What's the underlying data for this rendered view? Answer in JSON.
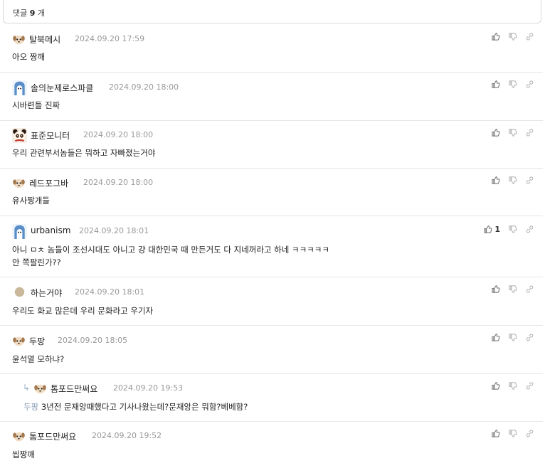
{
  "header": {
    "count_prefix": "댓글",
    "count": "9",
    "count_suffix": "개"
  },
  "comments": [
    {
      "author": "탈북메시",
      "date": "2024.09.20 17:59",
      "text": "아오 짱깨",
      "avatar": "dog-avatar"
    },
    {
      "author": "솔의눈제로스파클",
      "date": "2024.09.20 18:00",
      "text": "시바련들 진짜",
      "avatar": "blue-avatar"
    },
    {
      "author": "표준모니터",
      "date": "2024.09.20 18:00",
      "text": "우리 관련부서놈들은 뭐하고 자빠졌는거야",
      "avatar": "panda-avatar"
    },
    {
      "author": "레드포그바",
      "date": "2024.09.20 18:00",
      "text": "유사짱개들",
      "avatar": "dog-avatar"
    },
    {
      "author": "urbanism",
      "date": "2024.09.20 18:01",
      "text_line1": "아니 ㅁㅊ 놈들이 조선시대도 아니고 걍 대한민국 때 만든거도 다 지네꺼라고 하네 ㅋㅋㅋㅋㅋ",
      "text_line2": "안 쪽팔린가??",
      "like_count": "1",
      "avatar": "blue-avatar"
    },
    {
      "author": "하는거야",
      "date": "2024.09.20 18:01",
      "text": "우리도 화교 많은데 우리 문화라고 우기자",
      "avatar": "circle-avatar"
    },
    {
      "author": "두팡",
      "date": "2024.09.20 18:05",
      "text": "윤석열 모하냐?",
      "avatar": "dog-avatar"
    },
    {
      "author": "톰포드만써요",
      "date": "2024.09.20 19:53",
      "mention": "두팡",
      "text": "3년전 문재앙때했다고 기사나왔는데?문재앙은 뭐함?베베함?",
      "avatar": "dog-avatar",
      "reply_icon": "reply-arrow-icon"
    },
    {
      "author": "톰포드만써요",
      "date": "2024.09.20 19:52",
      "text": "씹짱깨",
      "avatar": "dog-avatar"
    }
  ],
  "icons": {
    "like": "thumbs-up-icon",
    "dislike": "thumbs-down-icon",
    "share": "link-icon"
  },
  "colors": {
    "date": "#999999",
    "mention": "#8aa0b4",
    "divider": "#e6e6e6"
  }
}
